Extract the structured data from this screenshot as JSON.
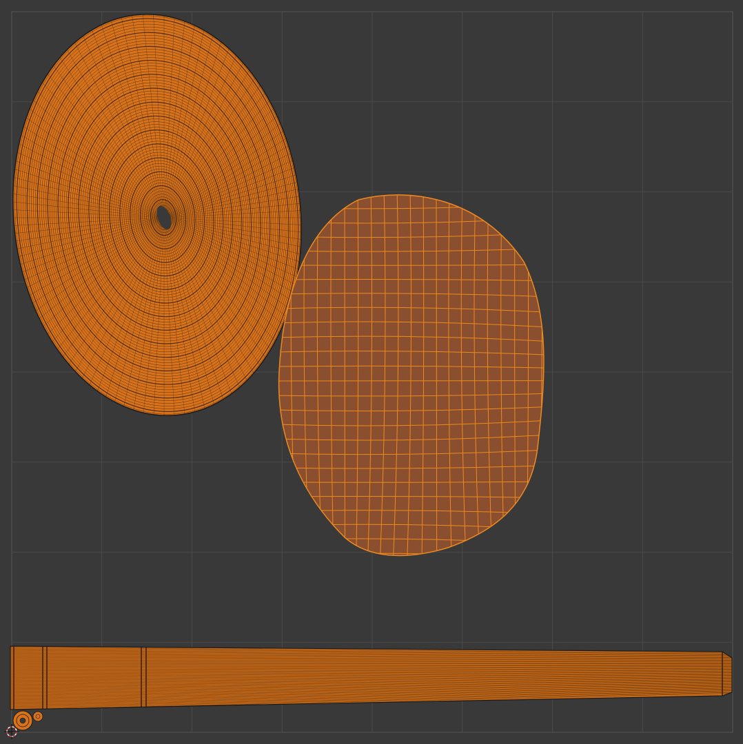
{
  "editor": {
    "type": "uv-editor",
    "background_color": "#393939",
    "grid_color": "#4a4a4a",
    "grid_border_color": "#555555"
  },
  "mesh": {
    "face_color": "#8a4f2e",
    "edge_color": "#f08a1e",
    "islands": [
      {
        "name": "spiral-disc-island",
        "selected": true
      },
      {
        "name": "oval-grid-island",
        "selected": true
      },
      {
        "name": "long-strip-island",
        "selected": true
      },
      {
        "name": "small-circle-island",
        "selected": true
      }
    ]
  },
  "cursor": {
    "icon": "2d-cursor-icon",
    "colors": [
      "#e04040",
      "#ffffff"
    ]
  }
}
